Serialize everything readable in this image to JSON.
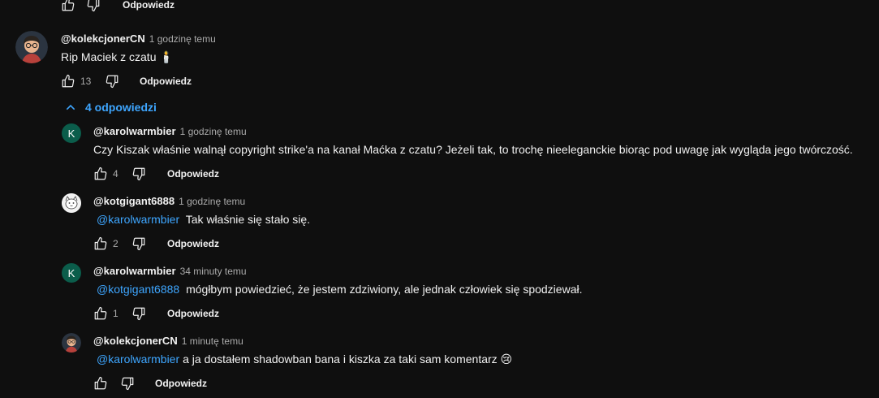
{
  "prev_comment": {
    "reply_label": "Odpowiedz"
  },
  "main_comment": {
    "author": "@kolekcjonerCN",
    "time": "1 godzinę temu",
    "text": "Rip Maciek z czatu 🕯️",
    "likes": "13",
    "reply_label": "Odpowiedz"
  },
  "replies_toggle": {
    "label": "4 odpowiedzi"
  },
  "replies": [
    {
      "author": "@karolwarmbier",
      "avatar_letter": "K",
      "time": "1 godzinę temu",
      "mention": "",
      "text": "Czy Kiszak właśnie walnął copyright strike'a na kanał Maćka z czatu? Jeżeli tak, to trochę nieeleganckie biorąc pod uwagę jak wygląda jego twórczość.",
      "likes": "4",
      "reply_label": "Odpowiedz"
    },
    {
      "author": "@kotgigant6888",
      "time": "1 godzinę temu",
      "mention": "@karolwarmbier",
      "text": "Tak właśnie się stało się.",
      "likes": "2",
      "reply_label": "Odpowiedz"
    },
    {
      "author": "@karolwarmbier",
      "avatar_letter": "K",
      "time": "34 minuty temu",
      "mention": "@kotgigant6888",
      "text": "mógłbym powiedzieć, że jestem zdziwiony, ale jednak człowiek się spodziewał.",
      "likes": "1",
      "reply_label": "Odpowiedz"
    },
    {
      "author": "@kolekcjonerCN",
      "time": "1 minutę temu",
      "mention": "@karolwarmbier",
      "text": "a ja dostałem shadowban bana i kiszka  za taki sam komentarz 😢",
      "likes": "",
      "reply_label": "Odpowiedz"
    }
  ],
  "colors": {
    "background": "#0f0f0f",
    "link": "#3ea6ff",
    "muted": "#aaaaaa",
    "avatar_k": "#0b5d4b"
  }
}
